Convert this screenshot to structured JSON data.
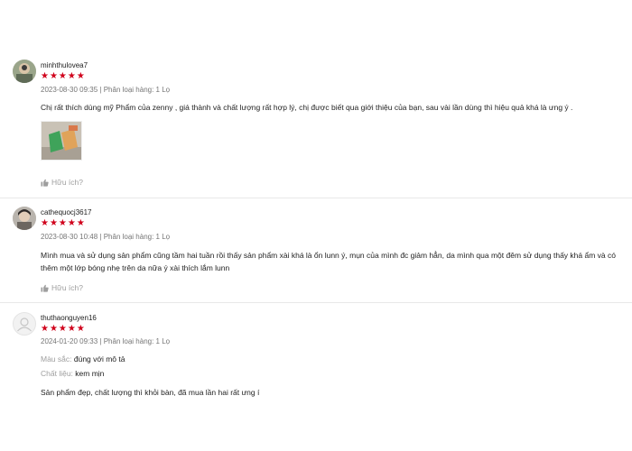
{
  "reviews": [
    {
      "username": "minhthulovea7",
      "stars": "★★★★★",
      "date": "2023-08-30 09:35",
      "variation": "Phân loại hàng: 1 Lọ",
      "text_lines": [
        "Chị rất thích dùng mỹ Phẩm của zenny , giá thành và chất lượng rất hợp lý, chị được biết qua giới thiệu của bạn, sau vài lần dùng thì hiệu quả khá là ưng ý ."
      ],
      "helpful_label": "Hữu ích?"
    },
    {
      "username": "cathequocj3617",
      "stars": "★★★★★",
      "date": "2023-08-30 10:48",
      "variation": "Phân loại hàng: 1 Lọ",
      "text_lines": [
        "Mình mua và sử dụng sản phẩm cũng tầm hai tuần rồi thấy sản phẩm xài khá là ổn lunn ý, mụn của mình đc giảm hẳn, da mình qua một đêm sử dụng thấy khá ẩm và có",
        "thêm một lớp bóng nhẹ trên da nữa ý xài thích lắm lunn"
      ],
      "helpful_label": "Hữu ích?"
    },
    {
      "username": "thuthaonguyen16",
      "stars": "★★★★★",
      "date": "2024-01-20 09:33",
      "variation": "Phân loại hàng: 1 Lọ",
      "attrs": [
        {
          "key": "Màu sắc:",
          "value": "đúng với mô tả"
        },
        {
          "key": "Chất liệu:",
          "value": "kem mịn"
        }
      ],
      "text_lines": [
        "Sản phẩm đẹp, chất lượng thì khỏi bàn, đã mua lần hai rất ưng í"
      ]
    }
  ],
  "colors": {
    "star": "#d0011b",
    "meta": "#757575",
    "muted": "#9e9e9e"
  }
}
